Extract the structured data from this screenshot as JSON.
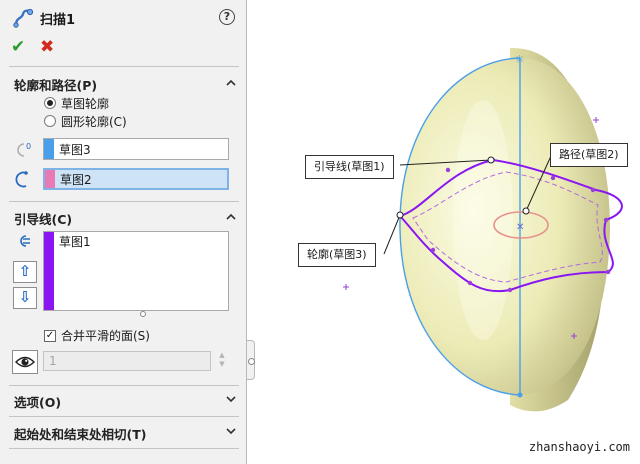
{
  "feature": {
    "title": "扫描1",
    "help": "?",
    "ok": "✔",
    "cancel": "✖"
  },
  "profile_path": {
    "header": "轮廓和路径(P)",
    "options": [
      {
        "label": "草图轮廓",
        "selected": true
      },
      {
        "label": "圆形轮廓(C)",
        "selected": false
      }
    ],
    "profile_value": "草图3",
    "path_value": "草图2",
    "profile_color": "#4a9fe8",
    "path_color": "#e87bb5"
  },
  "guides": {
    "header": "引导线(C)",
    "items": [
      "草图1"
    ],
    "color": "#8a16f2",
    "up": "⇧",
    "down": "⇩",
    "merge_label": "合并平滑的面(S)",
    "merge_checked": true,
    "count": "1"
  },
  "sections": {
    "options": "选项(O)",
    "tangency": "起始处和结束处相切(T)"
  },
  "viewport": {
    "callouts": {
      "guide": "引导线(草图1)",
      "path": "路径(草图2)",
      "profile": "轮廓(草图3)"
    },
    "watermark": "zhanshaoyi.com"
  }
}
